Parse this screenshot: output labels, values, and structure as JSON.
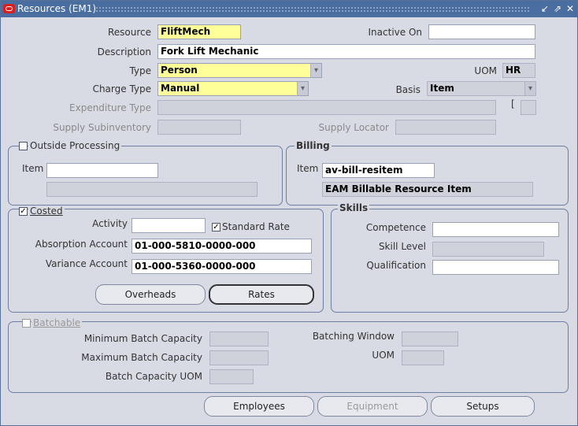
{
  "window": {
    "title": "Resources (EM1)"
  },
  "fields": {
    "resource": {
      "label": "Resource",
      "value": "FliftMech"
    },
    "inactive_on": {
      "label": "Inactive On",
      "value": ""
    },
    "description": {
      "label": "Description",
      "value": "Fork Lift Mechanic"
    },
    "type": {
      "label": "Type",
      "value": "Person"
    },
    "uom": {
      "label": "UOM",
      "value": "HR"
    },
    "charge_type": {
      "label": "Charge Type",
      "value": "Manual"
    },
    "basis": {
      "label": "Basis",
      "value": "Item"
    },
    "expenditure_type": {
      "label": "Expenditure Type",
      "value": "",
      "bracket": "["
    },
    "supply_subinventory": {
      "label": "Supply Subinventory",
      "value": ""
    },
    "supply_locator": {
      "label": "Supply Locator",
      "value": ""
    }
  },
  "outside_processing": {
    "label": "Outside Processing",
    "checked": false,
    "item_label": "Item",
    "item_value": "",
    "item_desc": ""
  },
  "billing": {
    "title": "Billing",
    "item_label": "Item",
    "item_value": "av-bill-resitem",
    "item_desc": "EAM Billable Resource Item"
  },
  "costed": {
    "label": "Costed",
    "checked": true,
    "activity_label": "Activity",
    "activity_value": "",
    "standard_rate_label": "Standard Rate",
    "standard_rate_checked": true,
    "absorption_label": "Absorption Account",
    "absorption_value": "01-000-5810-0000-000",
    "variance_label": "Variance Account",
    "variance_value": "01-000-5360-0000-000",
    "overheads_button": "Overheads",
    "rates_button": "Rates"
  },
  "skills": {
    "title": "Skills",
    "competence_label": "Competence",
    "competence_value": "",
    "skill_level_label": "Skill Level",
    "skill_level_value": "",
    "qualification_label": "Qualification",
    "qualification_value": ""
  },
  "batchable": {
    "label": "Batchable",
    "checked": false,
    "min_label": "Minimum Batch Capacity",
    "max_label": "Maximum Batch Capacity",
    "uom_label": "Batch Capacity UOM",
    "window_label": "Batching Window",
    "uom2_label": "UOM"
  },
  "buttons": {
    "employees": "Employees",
    "equipment": "Equipment",
    "setups": "Setups"
  },
  "icons": {
    "oracle_logo": "oracle-logo-icon",
    "minimize": "minimize-icon",
    "maximize": "maximize-icon",
    "close": "close-icon"
  },
  "colors": {
    "titlebar": "#4a6ea0",
    "required": "#ffff99",
    "background": "#d8dae4"
  }
}
